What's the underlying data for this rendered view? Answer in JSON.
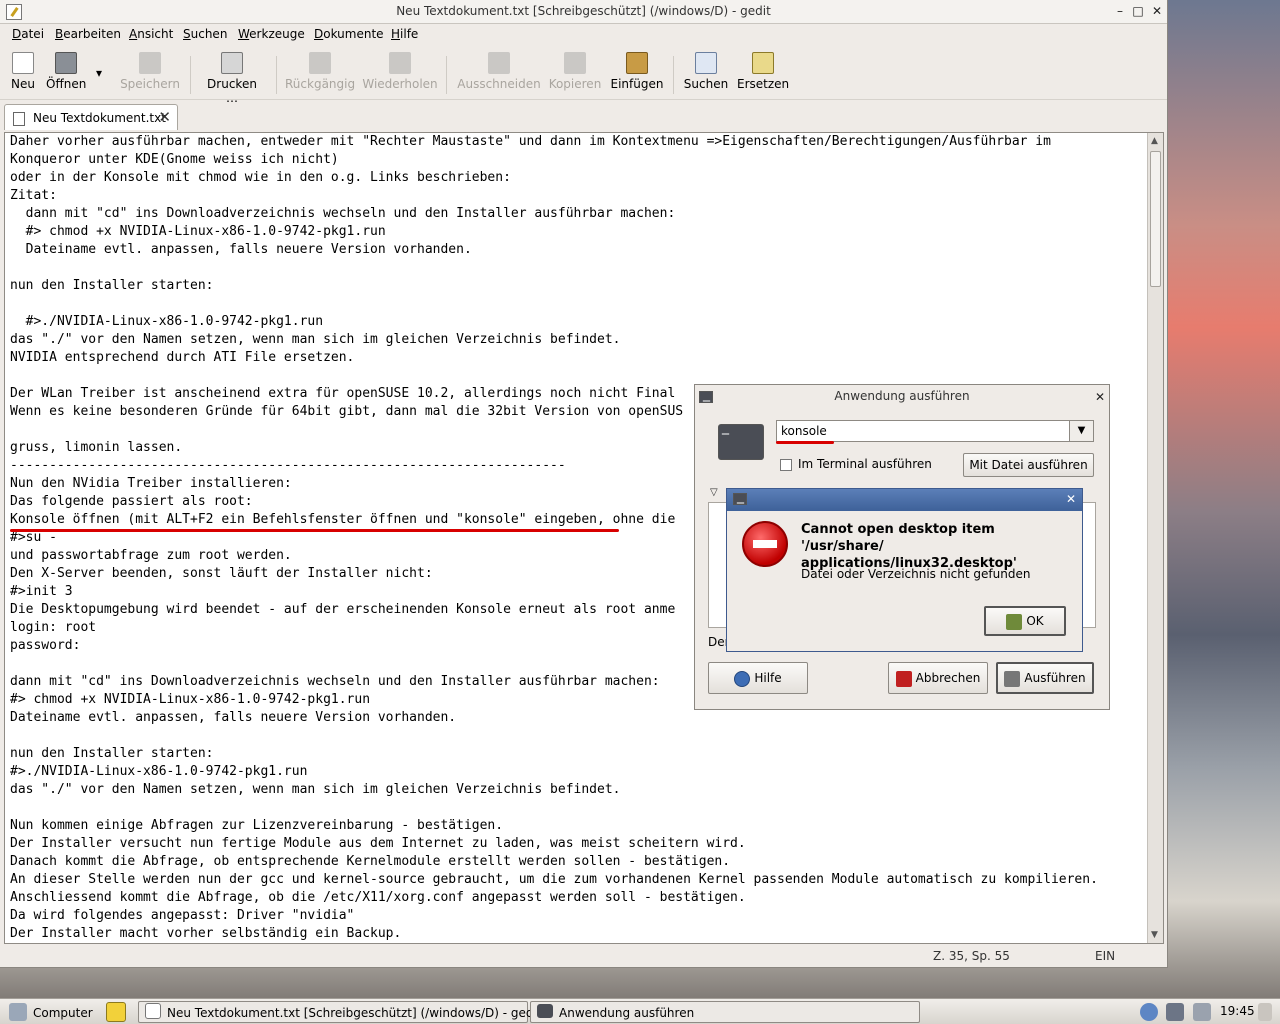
{
  "window": {
    "title": "Neu Textdokument.txt [Schreibgeschützt] (/windows/D) - gedit",
    "btn_min": "–",
    "btn_max": "□",
    "btn_close": "✕"
  },
  "menu": [
    "Datei",
    "Bearbeiten",
    "Ansicht",
    "Suchen",
    "Werkzeuge",
    "Dokumente",
    "Hilfe"
  ],
  "toolbar": {
    "new": "Neu",
    "open": "Öffnen",
    "save": "Speichern",
    "print": "Drucken …",
    "undo": "Rückgängig",
    "redo": "Wiederholen",
    "cut": "Ausschneiden",
    "copy": "Kopieren",
    "paste": "Einfügen",
    "find": "Suchen",
    "replace": "Ersetzen",
    "dropdown": "▾"
  },
  "tab": {
    "label": "Neu Textdokument.txt",
    "close": "✕"
  },
  "editor": {
    "text": "Daher vorher ausführbar machen, entweder mit \"Rechter Maustaste\" und dann im Kontextmenu =>Eigenschaften/Berechtigungen/Ausführbar im\nKonqueror unter KDE(Gnome weiss ich nicht)\noder in der Konsole mit chmod wie in den o.g. Links beschrieben:\nZitat:\n  dann mit \"cd\" ins Downloadverzeichnis wechseln und den Installer ausführbar machen:\n  #> chmod +x NVIDIA-Linux-x86-1.0-9742-pkg1.run\n  Dateiname evtl. anpassen, falls neuere Version vorhanden.\n\nnun den Installer starten:\n\n  #>./NVIDIA-Linux-x86-1.0-9742-pkg1.run\ndas \"./\" vor den Namen setzen, wenn man sich im gleichen Verzeichnis befindet.\nNVIDIA entsprechend durch ATI File ersetzen.\n\nDer WLan Treiber ist anscheinend extra für openSUSE 10.2, allerdings noch nicht Final\nWenn es keine besonderen Gründe für 64bit gibt, dann mal die 32bit Version von openSUS\n\ngruss, limonin lassen.\n-----------------------------------------------------------------------\nNun den NVidia Treiber installieren:\nDas folgende passiert als root:\nKonsole öffnen (mit ALT+F2 ein Befehlsfenster öffnen und \"konsole\" eingeben, ohne die\n#>su -\nund passwortabfrage zum root werden.\nDen X-Server beenden, sonst läuft der Installer nicht:\n#>init 3\nDie Desktopumgebung wird beendet - auf der erscheinenden Konsole erneut als root anme\nlogin: root\npassword:\n\ndann mit \"cd\" ins Downloadverzeichnis wechseln und den Installer ausführbar machen:\n#> chmod +x NVIDIA-Linux-x86-1.0-9742-pkg1.run\nDateiname evtl. anpassen, falls neuere Version vorhanden.\n\nnun den Installer starten:\n#>./NVIDIA-Linux-x86-1.0-9742-pkg1.run\ndas \"./\" vor den Namen setzen, wenn man sich im gleichen Verzeichnis befindet.\n\nNun kommen einige Abfragen zur Lizenzvereinbarung - bestätigen.\nDer Installer versucht nun fertige Module aus dem Internet zu laden, was meist scheitern wird.\nDanach kommt die Abfrage, ob entsprechende Kernelmodule erstellt werden sollen - bestätigen.\nAn dieser Stelle werden nun der gcc und kernel-source gebraucht, um die zum vorhandenen Kernel passenden Module automatisch zu kompilieren.\nAnschliessend kommt die Abfrage, ob die /etc/X11/xorg.conf angepasst werden soll - bestätigen.\nDa wird folgendes angepasst: Driver \"nvidia\"\nDer Installer macht vorher selbständig ein Backup."
  },
  "scroll": {
    "up": "▲",
    "down": "▼"
  },
  "status": {
    "position": "Z. 35, Sp. 55",
    "mode": "EIN"
  },
  "run_dialog": {
    "title": "Anwendung ausführen",
    "close": "✕",
    "command_value": "konsole",
    "combo_arrow": "▼",
    "terminal_checkbox": "Im Terminal ausführen",
    "with_file_button": "Mit Datei ausführen …",
    "expander": "▽",
    "partial_label": "Der",
    "help_button": "Hilfe",
    "cancel_button": "Abbrechen",
    "run_button": "Ausführen"
  },
  "error_dialog": {
    "close": "✕",
    "heading": "Cannot open desktop item '/usr/share/ applications/linux32.desktop'",
    "message": "Datei oder Verzeichnis nicht gefunden",
    "ok_button": "OK"
  },
  "taskbar": {
    "computer": "Computer",
    "task_gedit": "Neu Textdokument.txt [Schreibgeschützt] (/windows/D) - gedit",
    "task_run": "Anwendung ausführen",
    "clock": "19:45"
  },
  "colors": {
    "accent_red": "#d80000",
    "error_title": "#3e6199"
  }
}
